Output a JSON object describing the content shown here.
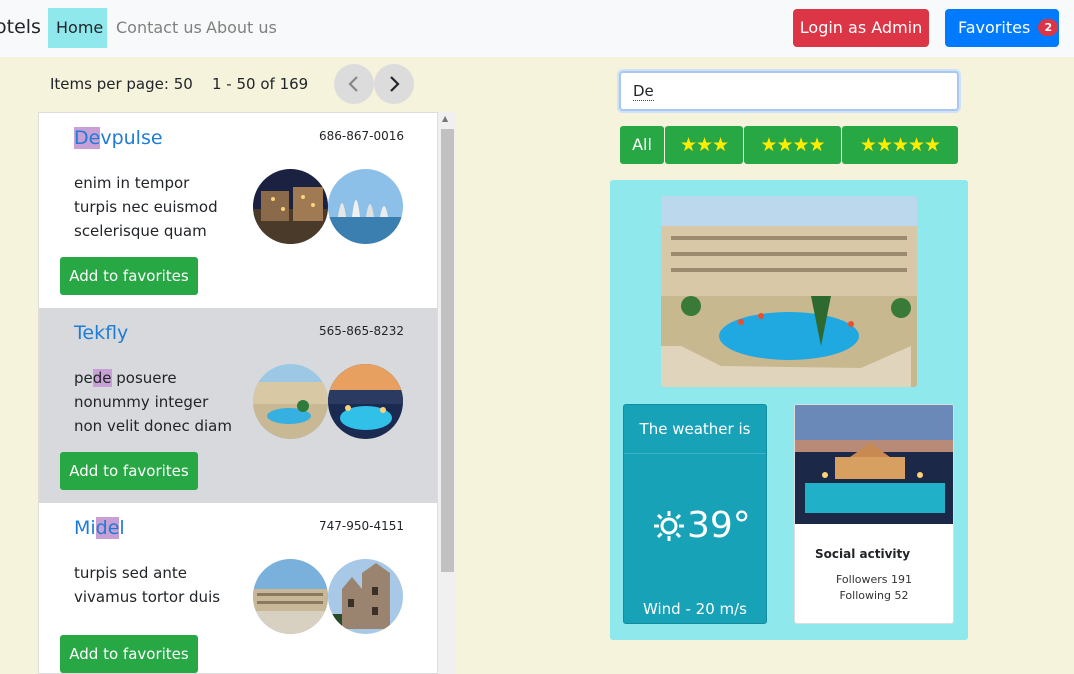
{
  "nav": {
    "brand": "otels",
    "links": [
      "Home",
      "Contact us",
      "About us"
    ],
    "admin_label": "Login as Admin",
    "favorites_label": "Favorites",
    "favorites_count": "2"
  },
  "paginator": {
    "items_label": "Items per page: 50",
    "range_label": "1 - 50 of 169",
    "prev_icon": "‹",
    "next_icon": "›"
  },
  "hotels": [
    {
      "name_hl": "De",
      "name_pre": "",
      "name_post": "vpulse",
      "phone": "686-867-0016",
      "desc_lines": [
        "enim in tempor",
        "turpis nec euismod",
        "scelerisque quam"
      ],
      "button": "Add to favorites"
    },
    {
      "name": "Tekfly",
      "phone": "565-865-8232",
      "desc_pre": "pe",
      "desc_hl": "de",
      "desc_post": " posuere",
      "desc_lines": [
        "nonummy integer",
        "non velit donec diam"
      ],
      "button": "Add to favorites"
    },
    {
      "name_pre": "Mi",
      "name_hl": "de",
      "name_post": "l",
      "phone": "747-950-4151",
      "desc_lines": [
        "turpis sed ante",
        "vivamus tortor duis"
      ],
      "button": "Add to favorites"
    }
  ],
  "search": {
    "value": "De"
  },
  "filters": {
    "all": "All",
    "three": "★★★",
    "four": "★★★★",
    "five": "★★★★★"
  },
  "weather": {
    "title": "The weather is",
    "temp": "39°",
    "wind": "Wind - 20 m/s",
    "icon": "sun-icon"
  },
  "social": {
    "title": "Social activity",
    "followers": "Followers 191",
    "following": "Following 52"
  },
  "colors": {
    "accent_green": "#28a745",
    "panel": "#8ee8ec",
    "admin_red": "#dc3545",
    "primary_blue": "#007bff",
    "weather_teal": "#17a2b8"
  }
}
